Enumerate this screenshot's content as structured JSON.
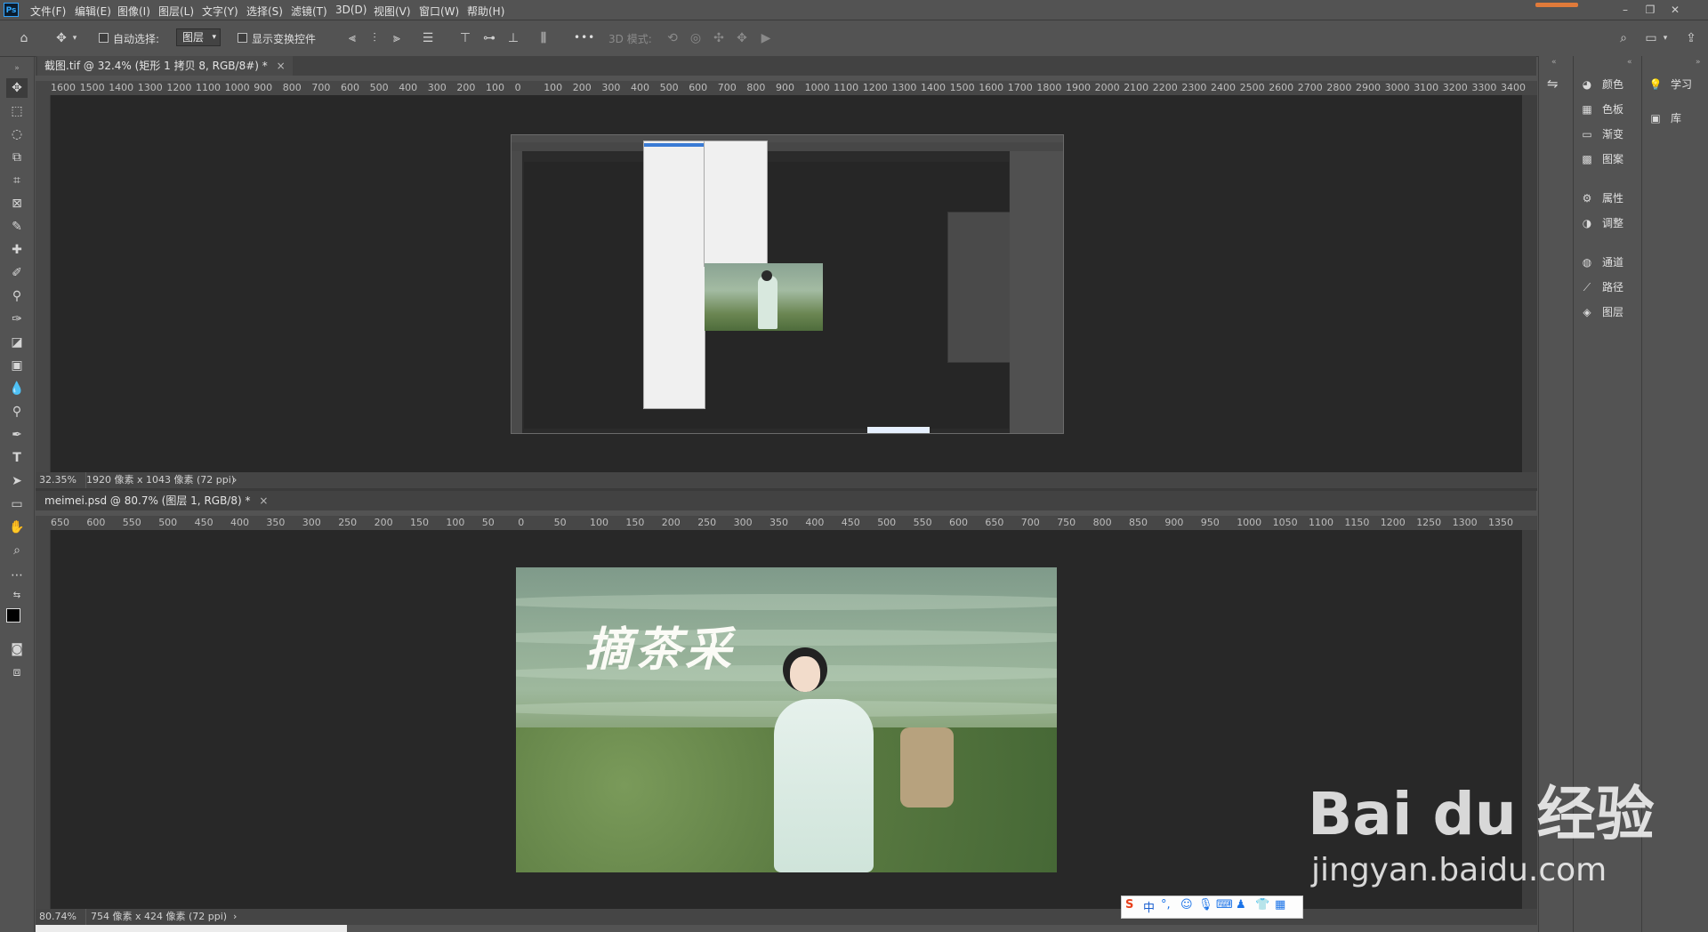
{
  "menubar": {
    "app_logo": "Ps",
    "items": [
      "文件(F)",
      "编辑(E)",
      "图像(I)",
      "图层(L)",
      "文字(Y)",
      "选择(S)",
      "滤镜(T)",
      "3D(D)",
      "视图(V)",
      "窗口(W)",
      "帮助(H)"
    ]
  },
  "optbar": {
    "auto_select_label": "自动选择:",
    "layer_select_value": "图层",
    "show_transform_label": "显示变换控件",
    "mode_3d_label": "3D 模式:",
    "more": "•••"
  },
  "doc1": {
    "tab_title": "截图.tif @ 32.4% (矩形 1 拷贝 8, RGB/8#) *",
    "ruler_labels": [
      "1600",
      "1500",
      "1400",
      "1300",
      "1200",
      "1100",
      "1000",
      "900",
      "800",
      "700",
      "600",
      "500",
      "400",
      "300",
      "200",
      "100",
      "0",
      "100",
      "200",
      "300",
      "400",
      "500",
      "600",
      "700",
      "800",
      "900",
      "1000",
      "1100",
      "1200",
      "1300",
      "1400",
      "1500",
      "1600",
      "1700",
      "1800",
      "1900",
      "2000",
      "2100",
      "2200",
      "2300",
      "2400",
      "2500",
      "2600",
      "2700",
      "2800",
      "2900",
      "3000",
      "3100",
      "3200",
      "3300",
      "3400"
    ],
    "zoom": "32.35%",
    "info": "1920 像素 x 1043 像素 (72 ppi)"
  },
  "doc2": {
    "tab_title": "meimei.psd @ 80.7% (图层 1, RGB/8) *",
    "ruler_labels": [
      "650",
      "600",
      "550",
      "500",
      "450",
      "400",
      "350",
      "300",
      "250",
      "200",
      "150",
      "100",
      "50",
      "0",
      "50",
      "100",
      "150",
      "200",
      "250",
      "300",
      "350",
      "400",
      "450",
      "500",
      "550",
      "600",
      "650",
      "700",
      "750",
      "800",
      "850",
      "900",
      "950",
      "1000",
      "1050",
      "1100",
      "1150",
      "1200",
      "1250",
      "1300",
      "1350"
    ],
    "zoom": "80.74%",
    "info": "754 像素 x 424 像素 (72 ppi)",
    "calligraphy": "摘茶采"
  },
  "panels": {
    "col1": [
      {
        "icon": "color-icon",
        "glyph": "◕",
        "label": "颜色"
      },
      {
        "icon": "swatches-icon",
        "glyph": "▦",
        "label": "色板"
      },
      {
        "icon": "gradient-icon",
        "glyph": "▭",
        "label": "渐变"
      },
      {
        "icon": "patterns-icon",
        "glyph": "▩",
        "label": "图案"
      },
      {
        "icon": "properties-icon",
        "glyph": "⚙",
        "label": "属性"
      },
      {
        "icon": "adjustments-icon",
        "glyph": "◑",
        "label": "调整"
      },
      {
        "icon": "channels-icon",
        "glyph": "◍",
        "label": "通道"
      },
      {
        "icon": "paths-icon",
        "glyph": "⟋",
        "label": "路径"
      },
      {
        "icon": "layers-icon",
        "glyph": "◈",
        "label": "图层"
      }
    ],
    "col2": [
      {
        "icon": "learn-icon",
        "glyph": "💡",
        "label": "学习"
      },
      {
        "icon": "libraries-icon",
        "glyph": "▣",
        "label": "库"
      }
    ]
  },
  "ime": {
    "label": "中"
  },
  "watermark": {
    "brand": "Bai du 经验",
    "url": "jingyan.baidu.com"
  }
}
